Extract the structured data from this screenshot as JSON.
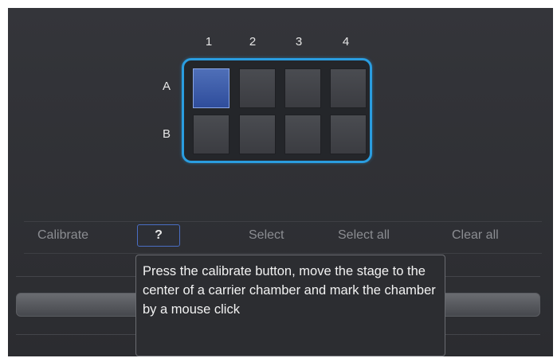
{
  "plate": {
    "columns": [
      "1",
      "2",
      "3",
      "4"
    ],
    "rows": [
      "A",
      "B"
    ],
    "selected_well": "A1"
  },
  "toolbar": {
    "calibrate_label": "Calibrate",
    "help_label": "?",
    "select_label": "Select",
    "select_all_label": "Select all",
    "clear_all_label": "Clear all"
  },
  "tooltip": {
    "text": "Press the calibrate button, move the stage to the center of a carrier chamber and mark the chamber by a mouse click"
  },
  "colors": {
    "accent": "#2a9de0",
    "selected_well": "#3d5fb0",
    "background": "#2f3034"
  }
}
